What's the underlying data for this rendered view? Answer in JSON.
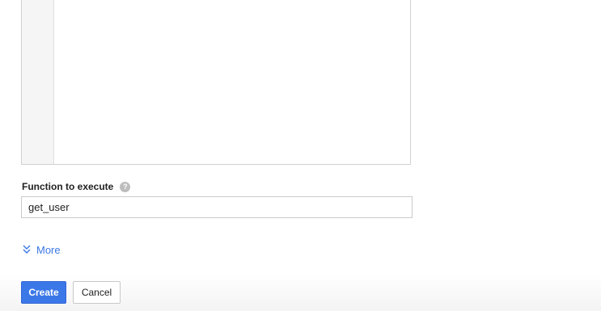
{
  "form": {
    "function_field": {
      "label": "Function to execute",
      "help_icon": "help-question-icon",
      "value": "get_user"
    },
    "more_toggle": {
      "label": "More",
      "icon": "double-chevron-down-icon"
    },
    "actions": {
      "create_label": "Create",
      "cancel_label": "Cancel"
    }
  },
  "colors": {
    "accent": "#3b78e7",
    "text": "#212121",
    "border": "#cccccc",
    "gutter": "#f5f5f5"
  }
}
